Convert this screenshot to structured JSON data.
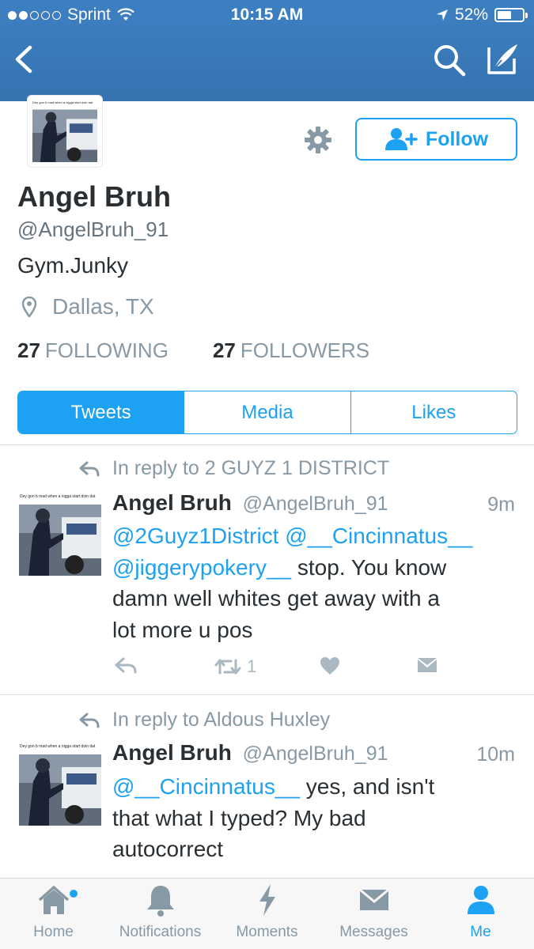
{
  "status_bar": {
    "carrier": "Sprint",
    "time": "10:15 AM",
    "battery": "52%",
    "battery_level": 0.52,
    "signal_bars_filled": 2,
    "signal_bars_total": 5
  },
  "nav": {
    "back_icon": "chevron-left-icon",
    "search_icon": "search-icon",
    "compose_icon": "compose-icon"
  },
  "profile": {
    "avatar_caption": "Dey gon b mad when a nigga start doin dat",
    "settings_icon": "gear-icon",
    "follow_label": "Follow",
    "name": "Angel Bruh",
    "handle": "@AngelBruh_91",
    "bio": "Gym.Junky",
    "location": "Dallas, TX",
    "following_count": "27",
    "following_label": "FOLLOWING",
    "followers_count": "27",
    "followers_label": "FOLLOWERS"
  },
  "tabs": [
    {
      "label": "Tweets",
      "active": true
    },
    {
      "label": "Media",
      "active": false
    },
    {
      "label": "Likes",
      "active": false
    }
  ],
  "tweets": [
    {
      "reply_context": "In reply to 2 GUYZ 1 DISTRICT",
      "name": "Angel Bruh",
      "handle": "@AngelBruh_91",
      "time": "9m",
      "avatar_caption": "Dey gon b mad when a nigga start doin dat",
      "line1_mention1": "@2Guyz1District",
      "line1_mention2": "@__Cincinnatus__",
      "line2_mention": "@jiggerypokery__",
      "line2_text": " stop. You know",
      "line3_text": "damn well whites get away with a",
      "line4_text": "lot more u pos",
      "retweet_count": "1"
    },
    {
      "reply_context": "In reply to Aldous Huxley",
      "name": "Angel Bruh",
      "handle": "@AngelBruh_91",
      "time": "10m",
      "avatar_caption": "Dey gon b mad when a nigga start doin dat",
      "line1_mention": "@__Cincinnatus__",
      "line1_text": " yes, and isn't",
      "line2_text": "that what I typed? My bad",
      "line3_text": "autocorrect"
    }
  ],
  "tabbar": [
    {
      "label": "Home",
      "icon": "home-icon",
      "active": false,
      "has_dot": true
    },
    {
      "label": "Notifications",
      "icon": "bell-icon",
      "active": false
    },
    {
      "label": "Moments",
      "icon": "lightning-icon",
      "active": false
    },
    {
      "label": "Messages",
      "icon": "envelope-icon",
      "active": false
    },
    {
      "label": "Me",
      "icon": "person-icon",
      "active": true
    }
  ],
  "colors": {
    "header_blue": "#3a7ab9",
    "accent": "#1da1f2",
    "muted": "#8899a6",
    "text": "#292f33"
  }
}
